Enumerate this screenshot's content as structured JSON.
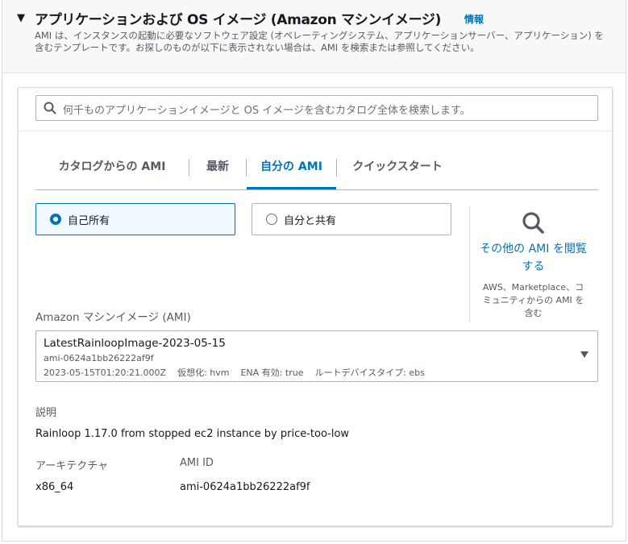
{
  "section": {
    "title": "アプリケーションおよび OS イメージ (Amazon マシンイメージ)",
    "info_link": "情報",
    "description": "AMI は、インスタンスの起動に必要なソフトウェア設定 (オペレーティングシステム、アプリケーションサーバー、アプリケーション) を含むテンプレートです。お探しのものが以下に表示されない場合は、AMI を検索または参照してください。"
  },
  "search": {
    "placeholder": "何千ものアプリケーションイメージと OS イメージを含むカタログ全体を検索します。"
  },
  "tabs": [
    {
      "label": "カタログからの AMI",
      "active": false
    },
    {
      "label": "最新",
      "active": false
    },
    {
      "label": "自分の AMI",
      "active": true
    },
    {
      "label": "クイックスタート",
      "active": false
    }
  ],
  "ownership": {
    "options": [
      {
        "label": "自己所有",
        "selected": true
      },
      {
        "label": "自分と共有",
        "selected": false
      }
    ]
  },
  "browse": {
    "link": "その他の AMI を閲覧する",
    "subtext": "AWS、Marketplace、コミュニティからの AMI を含む",
    "icon": "search-icon"
  },
  "ami_select": {
    "label": "Amazon マシンイメージ (AMI)",
    "name": "LatestRainloopImage-2023-05-15",
    "id": "ami-0624a1bb26222af9f",
    "date": "2023-05-15T01:20:21.000Z",
    "virtualization": "仮想化: hvm",
    "ena": "ENA 有効: true",
    "root_device": "ルートデバイスタイプ: ebs"
  },
  "details": {
    "description_key": "説明",
    "description_value": "Rainloop 1.17.0 from stopped ec2 instance by price-too-low",
    "arch_key": "アーキテクチャ",
    "arch_value": "x86_64",
    "ami_id_key": "AMI ID",
    "ami_id_value": "ami-0624a1bb26222af9f"
  },
  "colors": {
    "accent": "#0073bb",
    "text": "#16191f",
    "muted": "#545b64",
    "border": "#aab7b8"
  }
}
